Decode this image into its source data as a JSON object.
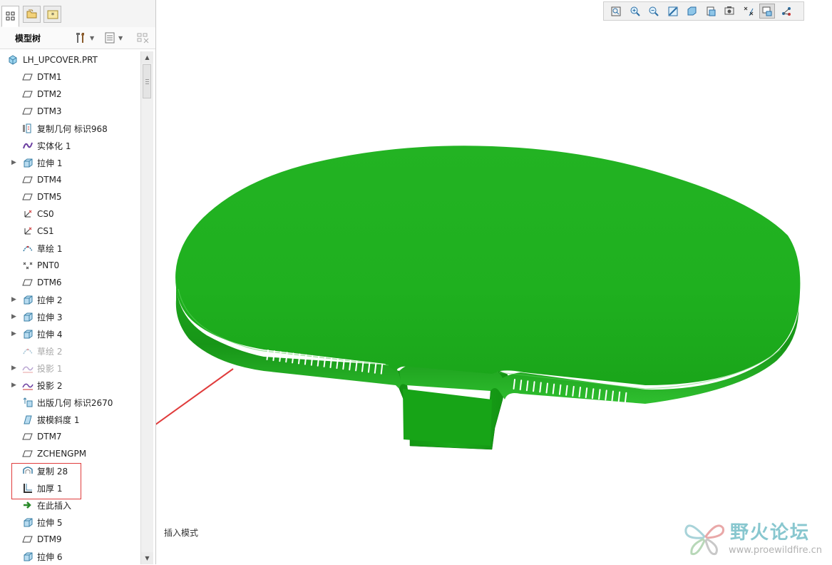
{
  "panel_tabs": [
    {
      "icon": "model-tree-tab-icon"
    },
    {
      "icon": "folder-browser-tab-icon"
    },
    {
      "icon": "favorites-tab-icon"
    }
  ],
  "tree_header": {
    "title": "模型树",
    "settings_icon": "settings-tools-icon",
    "show_icon": "tree-columns-icon",
    "filter_icon": "tree-filter-icon"
  },
  "tree": {
    "root": {
      "label": "LH_UPCOVER.PRT",
      "icon": "part-icon"
    },
    "items": [
      {
        "label": "DTM1",
        "icon": "datum-plane-icon",
        "expandable": false,
        "dimmed": false
      },
      {
        "label": "DTM2",
        "icon": "datum-plane-icon",
        "expandable": false,
        "dimmed": false
      },
      {
        "label": "DTM3",
        "icon": "datum-plane-icon",
        "expandable": false,
        "dimmed": false
      },
      {
        "label": "复制几何 标识968",
        "icon": "copy-geometry-icon",
        "expandable": false,
        "dimmed": false
      },
      {
        "label": "实体化 1",
        "icon": "solidify-icon",
        "expandable": false,
        "dimmed": false
      },
      {
        "label": "拉伸 1",
        "icon": "extrude-icon",
        "expandable": true,
        "dimmed": false
      },
      {
        "label": "DTM4",
        "icon": "datum-plane-icon",
        "expandable": false,
        "dimmed": false
      },
      {
        "label": "DTM5",
        "icon": "datum-plane-icon",
        "expandable": false,
        "dimmed": false
      },
      {
        "label": "CS0",
        "icon": "coordinate-system-icon",
        "expandable": false,
        "dimmed": false
      },
      {
        "label": "CS1",
        "icon": "coordinate-system-icon",
        "expandable": false,
        "dimmed": false
      },
      {
        "label": "草绘 1",
        "icon": "sketch-icon",
        "expandable": false,
        "dimmed": false
      },
      {
        "label": "PNT0",
        "icon": "datum-point-icon",
        "expandable": false,
        "dimmed": false
      },
      {
        "label": "DTM6",
        "icon": "datum-plane-icon",
        "expandable": false,
        "dimmed": false
      },
      {
        "label": "拉伸 2",
        "icon": "extrude-icon",
        "expandable": true,
        "dimmed": false
      },
      {
        "label": "拉伸 3",
        "icon": "extrude-icon",
        "expandable": true,
        "dimmed": false
      },
      {
        "label": "拉伸 4",
        "icon": "extrude-icon",
        "expandable": true,
        "dimmed": false
      },
      {
        "label": "草绘 2",
        "icon": "sketch-icon",
        "expandable": false,
        "dimmed": true
      },
      {
        "label": "投影 1",
        "icon": "projection-icon",
        "expandable": true,
        "dimmed": true
      },
      {
        "label": "投影 2",
        "icon": "projection-icon",
        "expandable": true,
        "dimmed": false
      },
      {
        "label": "出版几何 标识2670",
        "icon": "publish-geometry-icon",
        "expandable": false,
        "dimmed": false
      },
      {
        "label": "拔模斜度 1",
        "icon": "draft-icon",
        "expandable": false,
        "dimmed": false
      },
      {
        "label": "DTM7",
        "icon": "datum-plane-icon",
        "expandable": false,
        "dimmed": false
      },
      {
        "label": "ZCHENGPM",
        "icon": "datum-plane-icon",
        "expandable": false,
        "dimmed": false
      },
      {
        "label": "复制 28",
        "icon": "copy-surface-icon",
        "expandable": false,
        "dimmed": false
      },
      {
        "label": "加厚 1",
        "icon": "thicken-icon",
        "expandable": false,
        "dimmed": false
      },
      {
        "label": "在此插入",
        "icon": "insert-here-arrow-icon",
        "expandable": false,
        "dimmed": false
      },
      {
        "label": "拉伸 5",
        "icon": "extrude-icon",
        "expandable": false,
        "dimmed": false
      },
      {
        "label": "DTM9",
        "icon": "datum-plane-icon",
        "expandable": false,
        "dimmed": false
      },
      {
        "label": "拉伸 6",
        "icon": "extrude-icon",
        "expandable": false,
        "dimmed": false
      }
    ]
  },
  "graphics_toolbar": [
    {
      "icon": "refit-icon"
    },
    {
      "icon": "zoom-in-icon"
    },
    {
      "icon": "zoom-out-icon"
    },
    {
      "icon": "repaint-icon"
    },
    {
      "icon": "display-style-icon"
    },
    {
      "icon": "saved-orientations-icon"
    },
    {
      "icon": "view-manager-icon"
    },
    {
      "icon": "datum-display-filters-icon"
    },
    {
      "icon": "annotation-display-icon"
    },
    {
      "icon": "spin-center-icon"
    }
  ],
  "status": {
    "mode_text": "插入模式"
  },
  "watermark": {
    "title": "野火论坛",
    "url": "www.proewildfire.cn"
  },
  "colors": {
    "model_green": "#1fb21f",
    "annotation_red": "#e03c3c"
  }
}
